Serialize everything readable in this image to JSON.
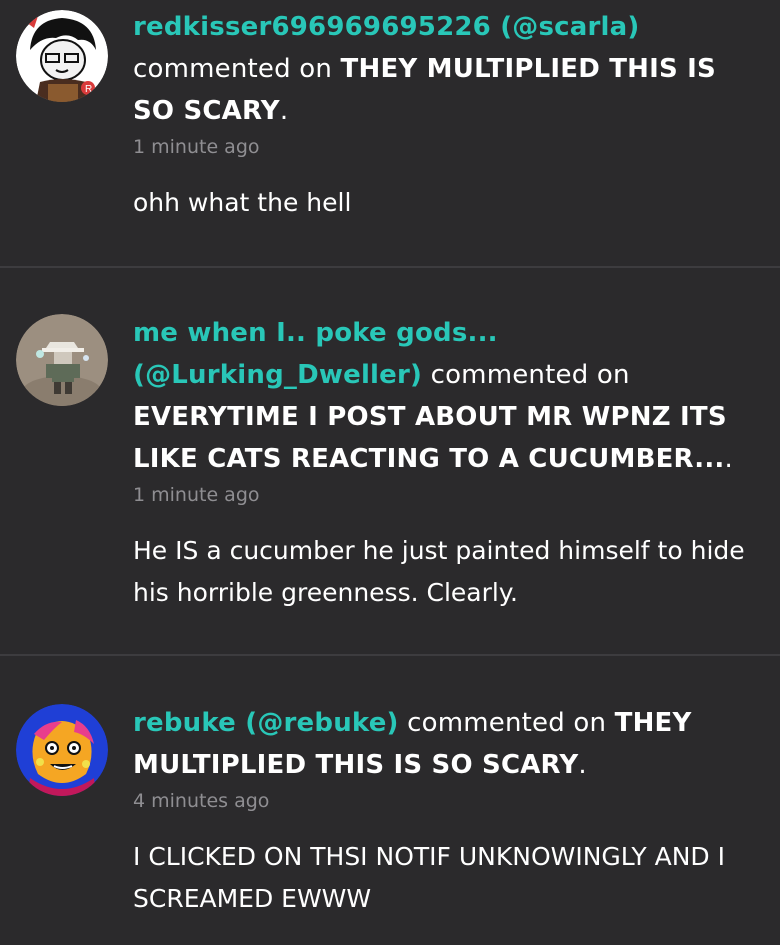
{
  "notifications": [
    {
      "user": "redkisser696969695226 (@scarla)",
      "verb": "commented on",
      "post": "THEY MULTIPLIED THIS IS SO SCARY",
      "trail": ".",
      "time": "1 minute ago",
      "body": "ohh what the hell",
      "avatar_icon": "anime-character-avatar-icon"
    },
    {
      "user": "me when I.. poke gods... (@Lurking_Dweller)",
      "verb": "commented on",
      "post": "EVERYTIME I POST ABOUT MR WPNZ ITS LIKE CATS REACTING TO A CUCUMBER...",
      "trail": ".",
      "time": "1 minute ago",
      "body": "He IS a cucumber he just painted himself to hide his horrible greenness. Clearly.",
      "avatar_icon": "cowboy-figure-avatar-icon"
    },
    {
      "user": "rebuke (@rebuke)",
      "verb": "commented on",
      "post": "THEY MULTIPLIED THIS IS SO SCARY",
      "trail": ".",
      "time": "4 minutes ago",
      "body": "I CLICKED ON THSI NOTIF UNKNOWINGLY AND I SCREAMED EWWW",
      "avatar_icon": "colorful-face-avatar-icon"
    }
  ]
}
